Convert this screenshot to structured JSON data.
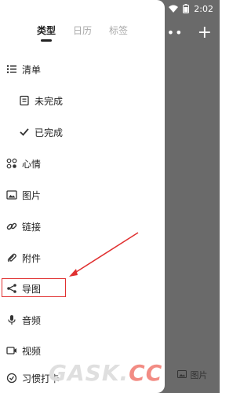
{
  "status_bar": {
    "time": "2:02",
    "wifi_icon": "wifi-icon",
    "battery_icon": "battery-icon"
  },
  "background": {
    "more_label": "•••",
    "add_label": "+",
    "bottom_image_label": "图片"
  },
  "drawer": {
    "tabs": [
      {
        "label": "类型",
        "active": true
      },
      {
        "label": "日历",
        "active": false
      },
      {
        "label": "标签",
        "active": false
      }
    ],
    "items": [
      {
        "label": "清单",
        "icon": "list-icon"
      },
      {
        "label": "未完成",
        "icon": "unfinished-icon"
      },
      {
        "label": "已完成",
        "icon": "check-icon"
      },
      {
        "label": "心情",
        "icon": "mood-icon"
      },
      {
        "label": "图片",
        "icon": "image-icon"
      },
      {
        "label": "链接",
        "icon": "link-icon"
      },
      {
        "label": "附件",
        "icon": "attachment-icon"
      },
      {
        "label": "导图",
        "icon": "mindmap-icon"
      },
      {
        "label": "音频",
        "icon": "mic-icon"
      },
      {
        "label": "视频",
        "icon": "video-icon"
      },
      {
        "label": "习惯打卡",
        "icon": "habit-icon"
      }
    ]
  },
  "annotation": {
    "highlight_color": "#e03030"
  },
  "watermark": {
    "text_main": "GASK.",
    "text_accent": "CC"
  }
}
